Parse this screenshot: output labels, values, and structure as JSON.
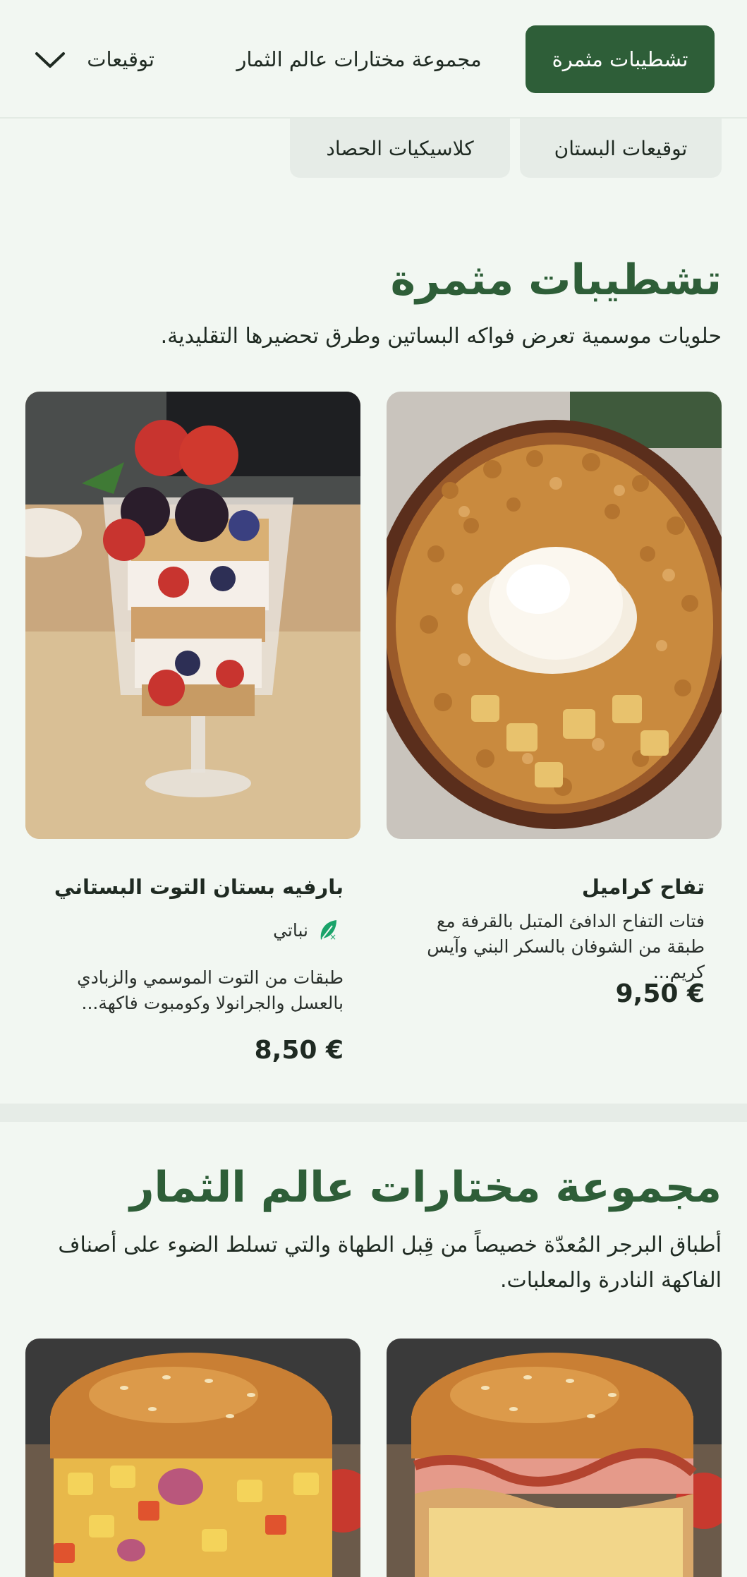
{
  "nav": {
    "active_tab": "تشطيبات مثمرة",
    "tab_2": "مجموعة مختارات عالم الثمار",
    "tab_3": "توقيعات",
    "more_icon": "chevron-down-icon"
  },
  "chips": [
    "توقيعات البستان",
    "كلاسيكيات الحصاد"
  ],
  "section_1": {
    "title": "تشطيبات مثمرة",
    "description": "حلويات موسمية تعرض فواكه البساتين وطرق تحضيرها التقليدية.",
    "items": [
      {
        "name": "تفاح كراميل",
        "description": "فتات التفاح الدافئ المتبل بالقرفة مع طبقة من الشوفان بالسكر البني وآيس كريم...",
        "price": "9,50 €",
        "image": "apple-crumble-photo"
      },
      {
        "name": "بارفيه بستان التوت البستاني",
        "badge": "نباتي",
        "badge_icon": "vegetarian-leaf-icon",
        "description": "طبقات من التوت الموسمي والزبادي بالعسل والجرانولا وكومبوت فاكهة...",
        "price": "8,50 €",
        "image": "berry-parfait-photo"
      }
    ]
  },
  "section_2": {
    "title": "مجموعة مختارات عالم الثمار",
    "description": "أطباق البرجر المُعدّة خصيصاً من قِبل الطهاة والتي تسلط الضوء على أصناف الفاكهة النادرة والمعلبات.",
    "items": [
      {
        "image": "bacon-burger-photo"
      },
      {
        "image": "fruit-salsa-burger-photo"
      }
    ]
  },
  "colors": {
    "brand_green": "#2e5e38",
    "background": "#f2f7f2",
    "chip_bg": "#e6ece7",
    "veg_green": "#1aa36a"
  }
}
